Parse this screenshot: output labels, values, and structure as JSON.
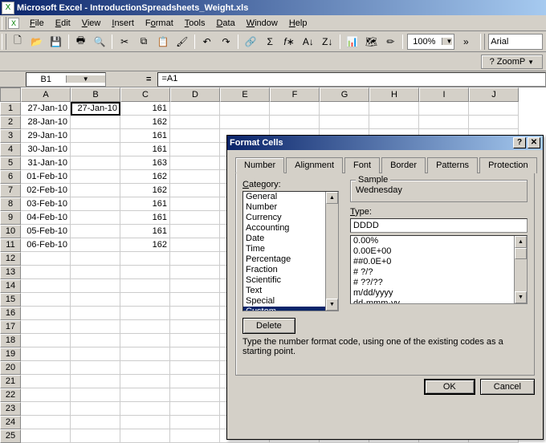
{
  "titlebar": {
    "app": "Microsoft Excel",
    "doc": "IntroductionSpreadsheets_Weight.xls"
  },
  "menu": {
    "file": "File",
    "edit": "Edit",
    "view": "View",
    "insert": "Insert",
    "format": "Format",
    "tools": "Tools",
    "data": "Data",
    "window": "Window",
    "help": "Help"
  },
  "toolbar": {
    "zoom": "100%",
    "font": "Arial",
    "zoomp": "?  ZoomP"
  },
  "namebox": "B1",
  "formula": "=A1",
  "columns": [
    "A",
    "B",
    "C",
    "D",
    "E",
    "F",
    "G",
    "H",
    "I",
    "J"
  ],
  "rows": [
    {
      "n": "1",
      "A": "27-Jan-10",
      "B": "27-Jan-10",
      "C": "161"
    },
    {
      "n": "2",
      "A": "28-Jan-10",
      "B": "",
      "C": "162"
    },
    {
      "n": "3",
      "A": "29-Jan-10",
      "B": "",
      "C": "161"
    },
    {
      "n": "4",
      "A": "30-Jan-10",
      "B": "",
      "C": "161"
    },
    {
      "n": "5",
      "A": "31-Jan-10",
      "B": "",
      "C": "163"
    },
    {
      "n": "6",
      "A": "01-Feb-10",
      "B": "",
      "C": "162"
    },
    {
      "n": "7",
      "A": "02-Feb-10",
      "B": "",
      "C": "162"
    },
    {
      "n": "8",
      "A": "03-Feb-10",
      "B": "",
      "C": "161"
    },
    {
      "n": "9",
      "A": "04-Feb-10",
      "B": "",
      "C": "161"
    },
    {
      "n": "10",
      "A": "05-Feb-10",
      "B": "",
      "C": "161"
    },
    {
      "n": "11",
      "A": "06-Feb-10",
      "B": "",
      "C": "162"
    },
    {
      "n": "12"
    },
    {
      "n": "13"
    },
    {
      "n": "14"
    },
    {
      "n": "15"
    },
    {
      "n": "16"
    },
    {
      "n": "17"
    },
    {
      "n": "18"
    },
    {
      "n": "19"
    },
    {
      "n": "20"
    },
    {
      "n": "21"
    },
    {
      "n": "22"
    },
    {
      "n": "23"
    },
    {
      "n": "24"
    },
    {
      "n": "25"
    }
  ],
  "dialog": {
    "title": "Format Cells",
    "tabs": {
      "number": "Number",
      "alignment": "Alignment",
      "font": "Font",
      "border": "Border",
      "patterns": "Patterns",
      "protection": "Protection"
    },
    "category_label": "Category:",
    "categories": [
      "General",
      "Number",
      "Currency",
      "Accounting",
      "Date",
      "Time",
      "Percentage",
      "Fraction",
      "Scientific",
      "Text",
      "Special",
      "Custom"
    ],
    "selected_category": "Custom",
    "sample_label": "Sample",
    "sample_value": "Wednesday",
    "type_label": "Type:",
    "type_value": "DDDD",
    "codes": [
      "0.00%",
      "0.00E+00",
      "##0.0E+0",
      "# ?/?",
      "# ??/??",
      "m/dd/yyyy",
      "dd-mmm-yy"
    ],
    "delete": "Delete",
    "help": "Type the number format code, using one of the existing codes as a starting point.",
    "ok": "OK",
    "cancel": "Cancel"
  }
}
